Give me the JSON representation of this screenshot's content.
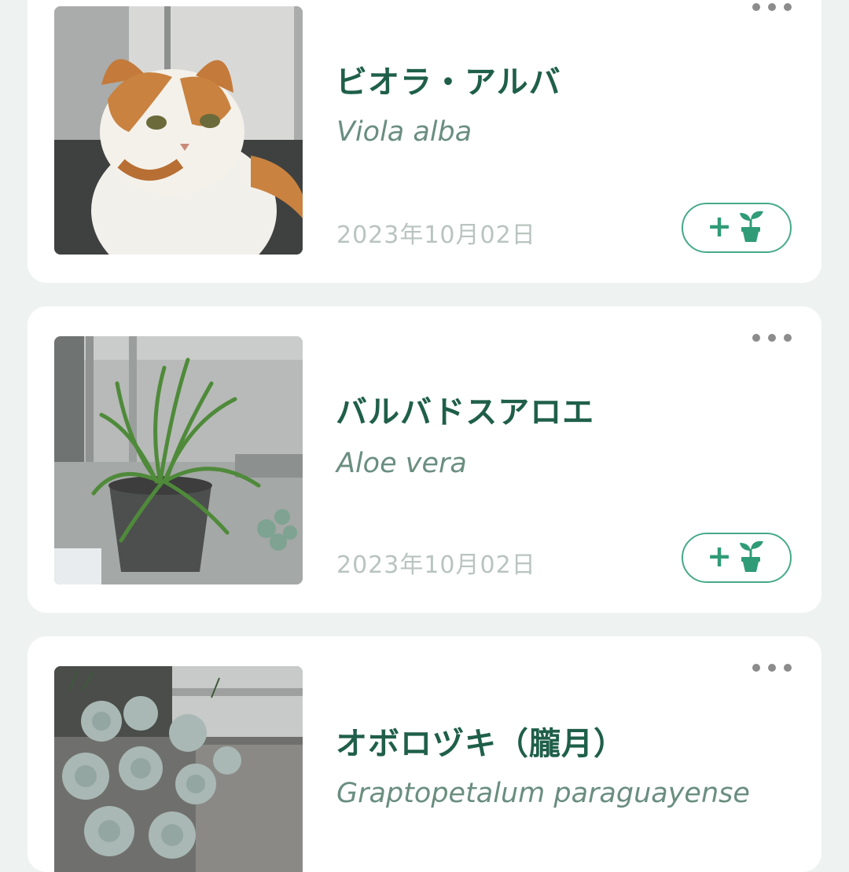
{
  "colors": {
    "background": "#eef3f1",
    "card": "#ffffff",
    "title": "#1f5f49",
    "scientific": "#6a8e80",
    "date": "#b9c4bf",
    "accent": "#2f9b77"
  },
  "cards": [
    {
      "name": "ビオラ・アルバ",
      "scientific_name": "Viola alba",
      "date": "2023年10月02日",
      "photo_subject": "orange-and-white cat",
      "add_button_plus": "+",
      "add_button_icon": "potted-plant-icon",
      "menu_icon": "more-options-icon"
    },
    {
      "name": "バルバドスアロエ",
      "scientific_name": "Aloe vera",
      "date": "2023年10月02日",
      "photo_subject": "aloe plant in pot",
      "add_button_plus": "+",
      "add_button_icon": "potted-plant-icon",
      "menu_icon": "more-options-icon"
    },
    {
      "name": "オボロヅキ（朧月）",
      "scientific_name": "Graptopetalum paraguayense",
      "photo_subject": "succulents in planter",
      "menu_icon": "more-options-icon"
    }
  ]
}
